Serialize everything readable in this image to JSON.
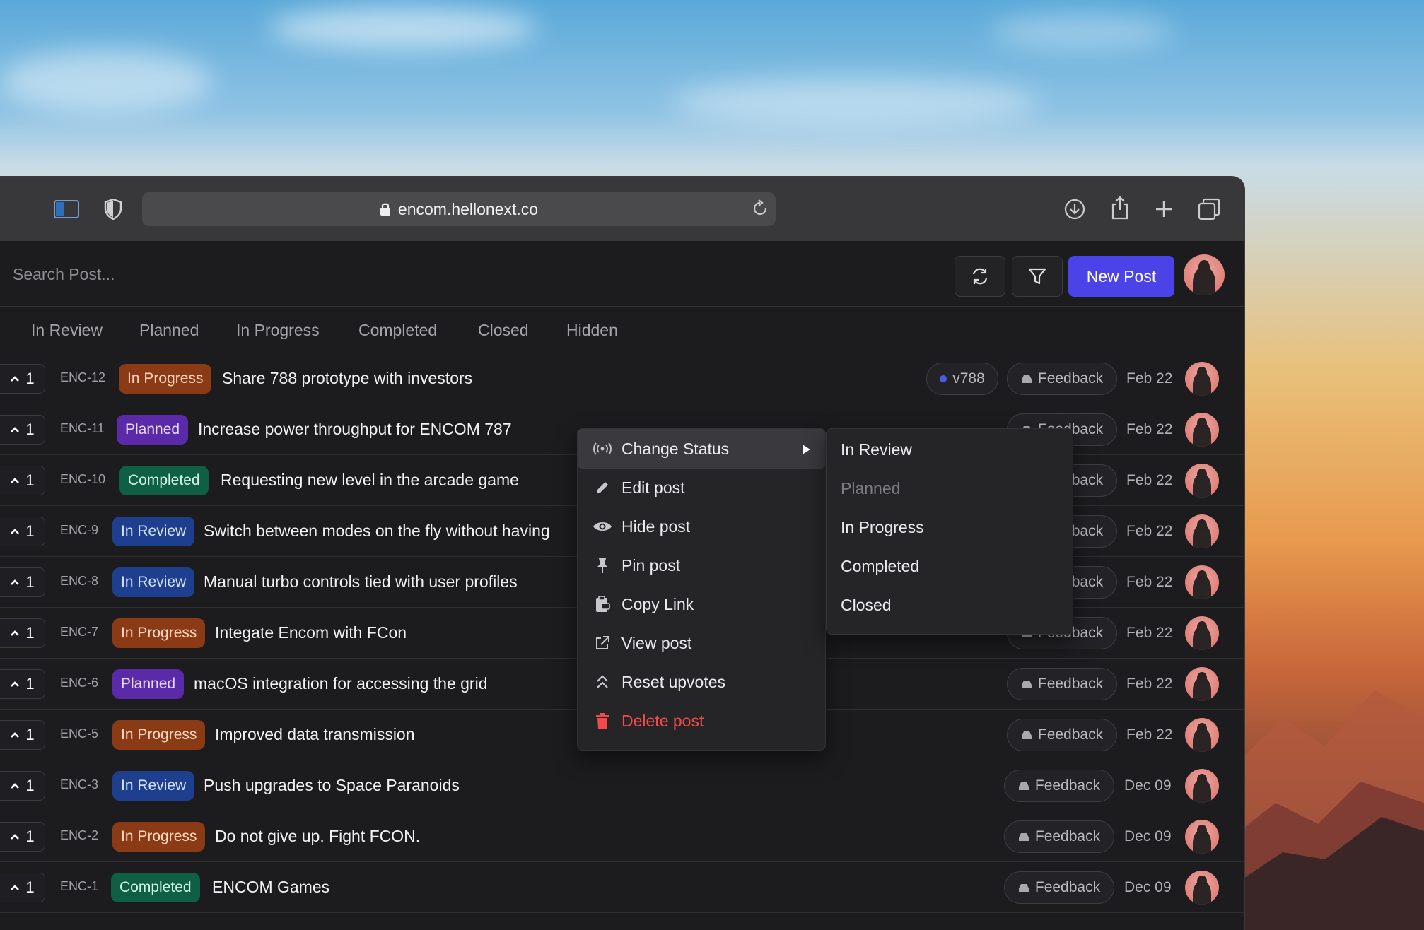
{
  "browser": {
    "url": "encom.hellonext.co"
  },
  "app": {
    "search_placeholder": "Search Post...",
    "new_post_label": "New Post"
  },
  "tabs": [
    "In Review",
    "Planned",
    "In Progress",
    "Completed",
    "Closed",
    "Hidden"
  ],
  "posts": [
    {
      "votes": "1",
      "id": "ENC-12",
      "status": "In Progress",
      "title": "Share 788 prototype with investors",
      "version": "v788",
      "category": "Feedback",
      "date": "Feb 22"
    },
    {
      "votes": "1",
      "id": "ENC-11",
      "status": "Planned",
      "title": "Increase power throughput for ENCOM 787",
      "category": "Feedback",
      "date": "Feb 22"
    },
    {
      "votes": "1",
      "id": "ENC-10",
      "status": "Completed",
      "title": "Requesting new level in the arcade game",
      "category": "Feedback",
      "date": "Feb 22"
    },
    {
      "votes": "1",
      "id": "ENC-9",
      "status": "In Review",
      "title": "Switch between modes on the fly without having",
      "category": "Feedback",
      "date": "Feb 22"
    },
    {
      "votes": "1",
      "id": "ENC-8",
      "status": "In Review",
      "title": "Manual turbo controls tied with user profiles",
      "category": "Feedback",
      "date": "Feb 22"
    },
    {
      "votes": "1",
      "id": "ENC-7",
      "status": "In Progress",
      "title": "Integate Encom with FCon",
      "category": "Feedback",
      "date": "Feb 22"
    },
    {
      "votes": "1",
      "id": "ENC-6",
      "status": "Planned",
      "title": "macOS integration for accessing the grid",
      "category": "Feedback",
      "date": "Feb 22"
    },
    {
      "votes": "1",
      "id": "ENC-5",
      "status": "In Progress",
      "title": "Improved data transmission",
      "category": "Feedback",
      "date": "Feb 22"
    },
    {
      "votes": "1",
      "id": "ENC-3",
      "status": "In Review",
      "title": "Push upgrades to Space Paranoids",
      "category": "Feedback",
      "date": "Dec 09"
    },
    {
      "votes": "1",
      "id": "ENC-2",
      "status": "In Progress",
      "title": "Do not give up. Fight FCON.",
      "category": "Feedback",
      "date": "Dec 09"
    },
    {
      "votes": "1",
      "id": "ENC-1",
      "status": "Completed",
      "title": "ENCOM Games",
      "category": "Feedback",
      "date": "Dec 09"
    }
  ],
  "context_menu": {
    "items": [
      {
        "label": "Change Status",
        "icon": "broadcast-icon"
      },
      {
        "label": "Edit post",
        "icon": "pencil-icon"
      },
      {
        "label": "Hide post",
        "icon": "eye-icon"
      },
      {
        "label": "Pin post",
        "icon": "pin-icon"
      },
      {
        "label": "Copy Link",
        "icon": "clipboard-icon"
      },
      {
        "label": "View post",
        "icon": "external-link-icon"
      },
      {
        "label": "Reset upvotes",
        "icon": "double-chevron-up-icon"
      },
      {
        "label": "Delete post",
        "icon": "trash-icon"
      }
    ],
    "submenu": [
      "In Review",
      "Planned",
      "In Progress",
      "Completed",
      "Closed"
    ]
  },
  "colors": {
    "accent": "#4b43e8",
    "in_progress": "#8a3a14",
    "planned": "#5b2aa8",
    "completed": "#0f5f44",
    "in_review": "#1d3f8e",
    "danger": "#ef4b4b"
  }
}
